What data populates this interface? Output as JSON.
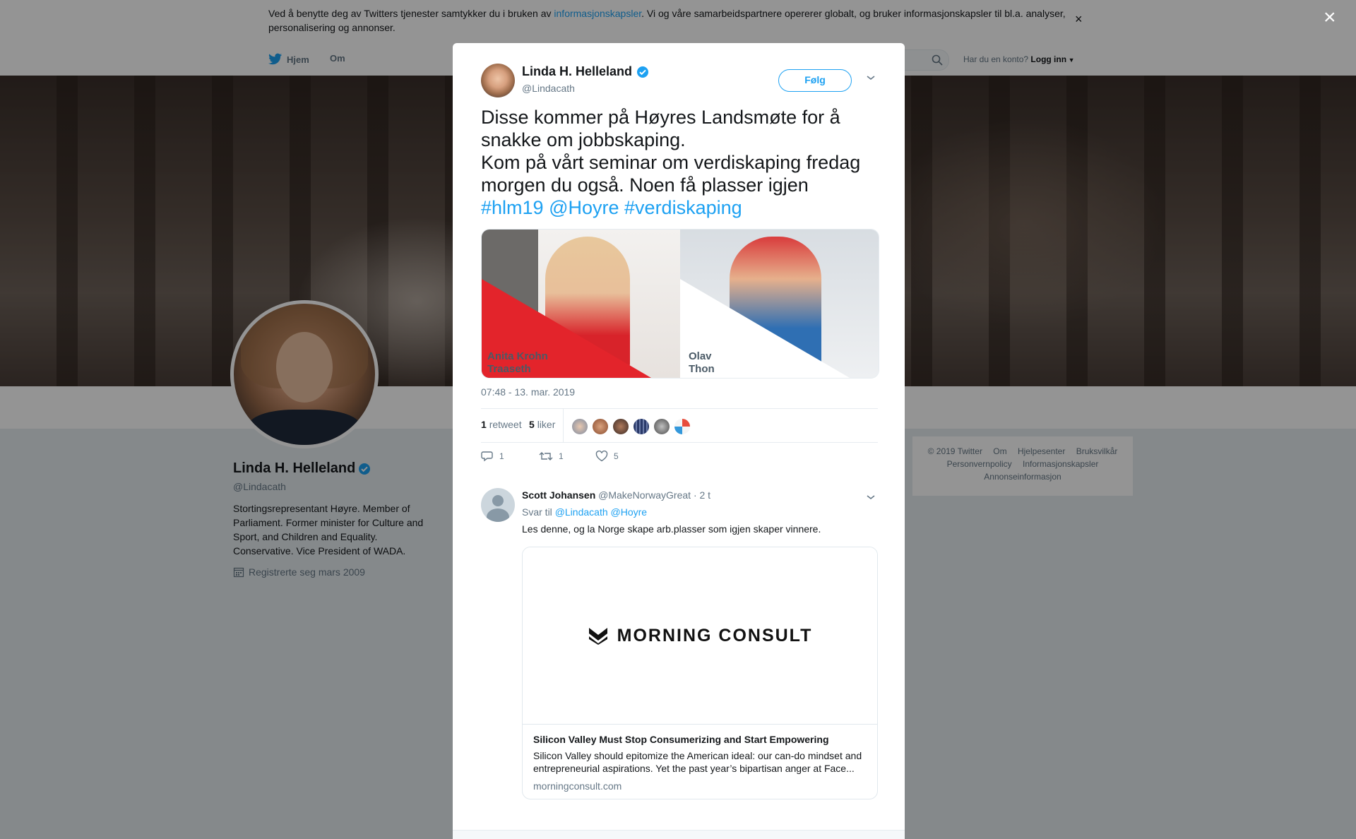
{
  "cookie": {
    "text_before": "Ved å benytte deg av Twitters tjenester samtykker du i bruken av ",
    "link": "informasjonskapsler",
    "text_after": ". Vi og våre samarbeidspartnere opererer globalt, og bruker informasjonskapsler til bl.a. analyser, personalisering og annonser.",
    "close": "×"
  },
  "nav": {
    "home": "Hjem",
    "about": "Om",
    "account_prompt": "Har du en konto?",
    "login": "Logg inn"
  },
  "profile": {
    "name": "Linda H. Helleland",
    "handle": "@Lindacath",
    "bio": "Stortingsrepresentant Høyre. Member of Parliament. Former minister for Culture and Sport, and Children and Equality. Conservative. Vice President of WADA.",
    "joined": "Registrerte seg mars 2009"
  },
  "footer": {
    "links": [
      "© 2019 Twitter",
      "Om",
      "Hjelpesenter",
      "Bruksvilkår",
      "Personvernpolicy",
      "Informasjonskapsler",
      "Annonseinformasjon"
    ]
  },
  "overlay": {
    "close": "×"
  },
  "tweet": {
    "name": "Linda H. Helleland",
    "handle": "@Lindacath",
    "follow": "Følg",
    "line1": "Disse kommer på Høyres Landsmøte for å snakke om jobbskaping.",
    "line2": "Kom på vårt seminar om verdiskaping fredag morgen du også. Noen få plasser igjen",
    "tags": [
      "#hlm19",
      "@Hoyre",
      "#verdiskaping"
    ],
    "media_left_label": [
      "Anita Krohn",
      "Traaseth"
    ],
    "media_right_label": [
      "Olav",
      "Thon"
    ],
    "time": "07:48 - 13. mar. 2019",
    "retweets_count": "1",
    "retweets_label": "retweet",
    "likes_count": "5",
    "likes_label": "liker",
    "actions": {
      "reply": "1",
      "retweet": "1",
      "like": "5"
    }
  },
  "reply": {
    "name": "Scott Johansen",
    "handle": "@MakeNorwayGreat",
    "time": "· 2 t",
    "reply_to_label": "Svar til",
    "reply_to": "@Lindacath @Hoyre",
    "text": "Les denne, og la Norge skape arb.plasser som igjen skaper vinnere.",
    "card": {
      "logo": "MORNING CONSULT",
      "title": "Silicon Valley Must Stop Consumerizing and Start Empowering",
      "description": "Silicon Valley should epitomize the American ideal: our can-do mindset and entrepreneurial aspirations. Yet the past year’s bipartisan anger at Face...",
      "domain": "morningconsult.com"
    }
  },
  "colors": {
    "accent": "#1da1f2",
    "verified": "#1da1f2",
    "overlay": "rgba(0,0,0,0.42)"
  }
}
